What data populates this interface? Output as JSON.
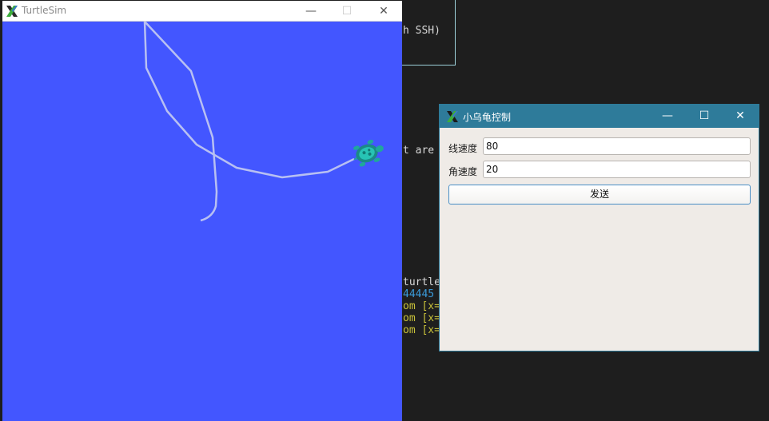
{
  "terminal": {
    "lines": [
      {
        "text": "h SSH)"
      },
      {
        "text": "t are"
      },
      {
        "text": "turtle"
      },
      {
        "text": "44445"
      },
      {
        "text": "om [x="
      },
      {
        "text": "om [x="
      },
      {
        "text": "om [x="
      }
    ]
  },
  "turtlesim": {
    "title": "TurtleSim",
    "background_color": "#4356ff",
    "trail_color": "#b8c0f2",
    "controls": {
      "minimize": "—",
      "maximize": "☐",
      "close": "✕"
    }
  },
  "control_dialog": {
    "title": "小乌龟控制",
    "titlebar_color": "#2e7b9a",
    "controls": {
      "minimize": "—",
      "maximize": "☐",
      "close": "✕"
    },
    "linear_speed": {
      "label": "线速度",
      "value": "80"
    },
    "angular_speed": {
      "label": "角速度",
      "value": "20"
    },
    "send_label": "发送"
  }
}
